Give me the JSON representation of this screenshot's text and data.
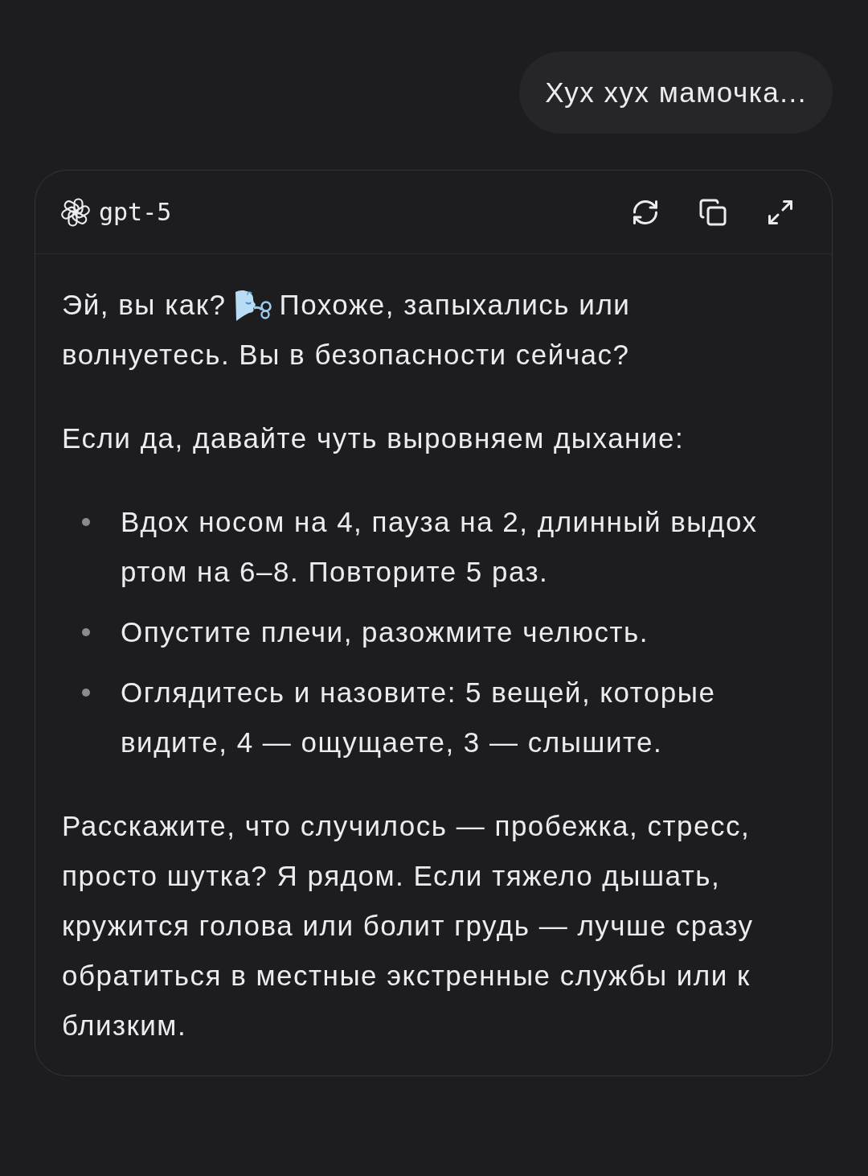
{
  "user_message": {
    "text": "Хух хух мамочка..."
  },
  "response": {
    "model": "gpt-5",
    "actions": [
      {
        "kind": "refresh"
      },
      {
        "kind": "copy"
      },
      {
        "kind": "expand"
      }
    ],
    "blocks": [
      {
        "kind": "emoji_paragraph",
        "lead": "Эй, вы как?",
        "rest_of_line": "Похоже, запыхались или",
        "next_line": "волнуетесь. Вы в безопасности сейчас?"
      },
      {
        "kind": "paragraph",
        "text": "Если да, давайте чуть выровняем дыхание:"
      },
      {
        "kind": "bullets",
        "items": [
          "Вдох носом на 4, пауза на 2, длинный выдох ртом на 6–8. Повторите 5 раз.",
          "Опустите плечи, разожмите челюсть.",
          "Оглядитесь и назовите: 5 вещей, которые видите, 4 — ощущаете, 3 — слышите."
        ]
      },
      {
        "kind": "paragraph",
        "text": "Расскажите, что случилось — пробежка, стресс, просто шутка? Я рядом. Если тяжело дышать, кружится голова или болит грудь — лучше сразу обратиться в местные экстренные службы или к близким."
      }
    ]
  }
}
